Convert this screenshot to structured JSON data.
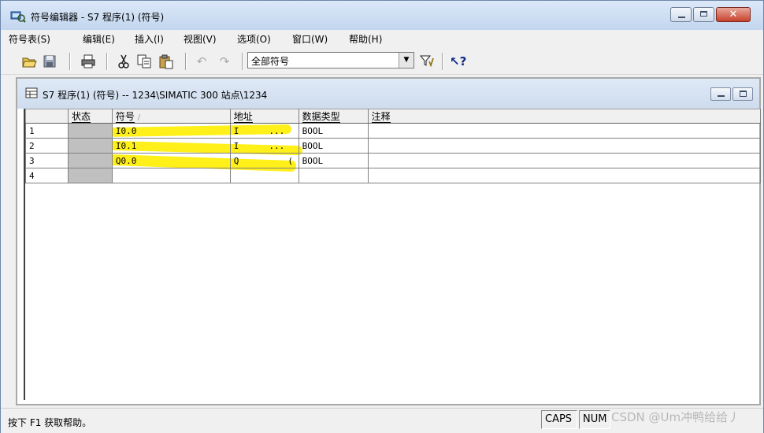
{
  "window": {
    "title": "符号编辑器 - S7 程序(1) (符号)",
    "app_icon": "symbol-editor-icon"
  },
  "menu": [
    "符号表(S)",
    "编辑(E)",
    "插入(I)",
    "视图(V)",
    "选项(O)",
    "窗口(W)",
    "帮助(H)"
  ],
  "toolbar": {
    "buttons": [
      "open-icon",
      "save-icon",
      "print-icon",
      "cut-icon",
      "copy-icon",
      "paste-icon",
      "undo-icon",
      "redo-icon",
      "filter-icon",
      "help-pointer-icon"
    ],
    "filter_value": "全部符号"
  },
  "child_window": {
    "title": "S7 程序(1) (符号) -- 1234\\SIMATIC 300 站点\\1234"
  },
  "table": {
    "columns": [
      "状态",
      "符号",
      "地址",
      "数据类型",
      "注释"
    ],
    "sort_indicator": "/",
    "rows": [
      {
        "num": "1",
        "symbol": "I0.0",
        "addr_prefix": "I",
        "addr_rest": "...",
        "type": "BOOL",
        "comment": ""
      },
      {
        "num": "2",
        "symbol": "I0.1",
        "addr_prefix": "I",
        "addr_rest": "...",
        "type": "BOOL",
        "comment": ""
      },
      {
        "num": "3",
        "symbol": "Q0.0",
        "addr_prefix": "Q",
        "addr_rest": "(",
        "type": "BOOL",
        "comment": ""
      },
      {
        "num": "4",
        "symbol": "",
        "addr_prefix": "",
        "addr_rest": "",
        "type": "",
        "comment": ""
      }
    ]
  },
  "status": {
    "help_text": "按下 F1 获取帮助。",
    "caps": "CAPS",
    "num": "NUM",
    "watermark": "CSDN @Um冲鸭给给丿"
  },
  "colors": {
    "highlight": "#ffee00",
    "state_cell": "#c0c0c0"
  }
}
